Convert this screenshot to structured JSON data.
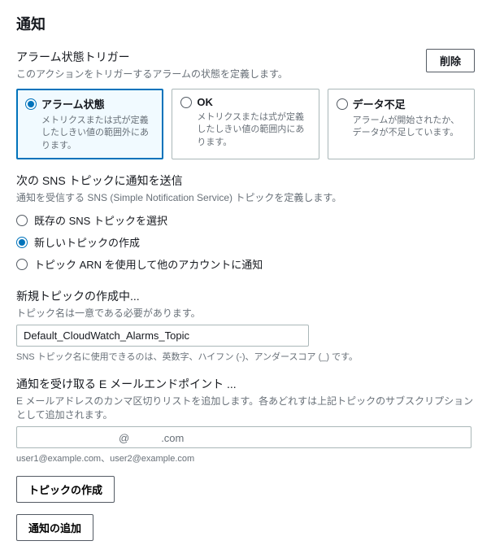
{
  "page": {
    "title": "通知"
  },
  "trigger": {
    "heading": "アラーム状態トリガー",
    "sub": "このアクションをトリガーするアラームの状態を定義します。",
    "deleteLabel": "削除",
    "options": [
      {
        "title": "アラーム状態",
        "desc": "メトリクスまたは式が定義したしきい値の範囲外にあります。",
        "selected": true
      },
      {
        "title": "OK",
        "desc": "メトリクスまたは式が定義したしきい値の範囲内にあります。",
        "selected": false
      },
      {
        "title": "データ不足",
        "desc": "アラームが開始されたか、データが不足しています。",
        "selected": false
      }
    ]
  },
  "snsTopic": {
    "heading": "次の SNS トピックに通知を送信",
    "sub": "通知を受信する SNS (Simple Notification Service) トピックを定義します。",
    "options": [
      {
        "label": "既存の SNS トピックを選択",
        "selected": false
      },
      {
        "label": "新しいトピックの作成",
        "selected": true
      },
      {
        "label": "トピック ARN を使用して他のアカウントに通知",
        "selected": false
      }
    ]
  },
  "newTopic": {
    "heading": "新規トピックの作成中...",
    "sub": "トピック名は一意である必要があります。",
    "value": "Default_CloudWatch_Alarms_Topic",
    "helper": "SNS トピック名に使用できるのは、英数字、ハイフン (-)、アンダースコア (_) です。"
  },
  "email": {
    "heading": "通知を受け取る E メールエンドポイント ...",
    "sub": "E メールアドレスのカンマ区切りリストを追加します。各あどれすは上記トピックのサブスクリプションとして追加されます。",
    "value": "　　　　　　　　　@　　　.com",
    "helper": "user1@example.com、user2@example.com"
  },
  "buttons": {
    "createTopic": "トピックの作成",
    "addNotification": "通知の追加"
  }
}
